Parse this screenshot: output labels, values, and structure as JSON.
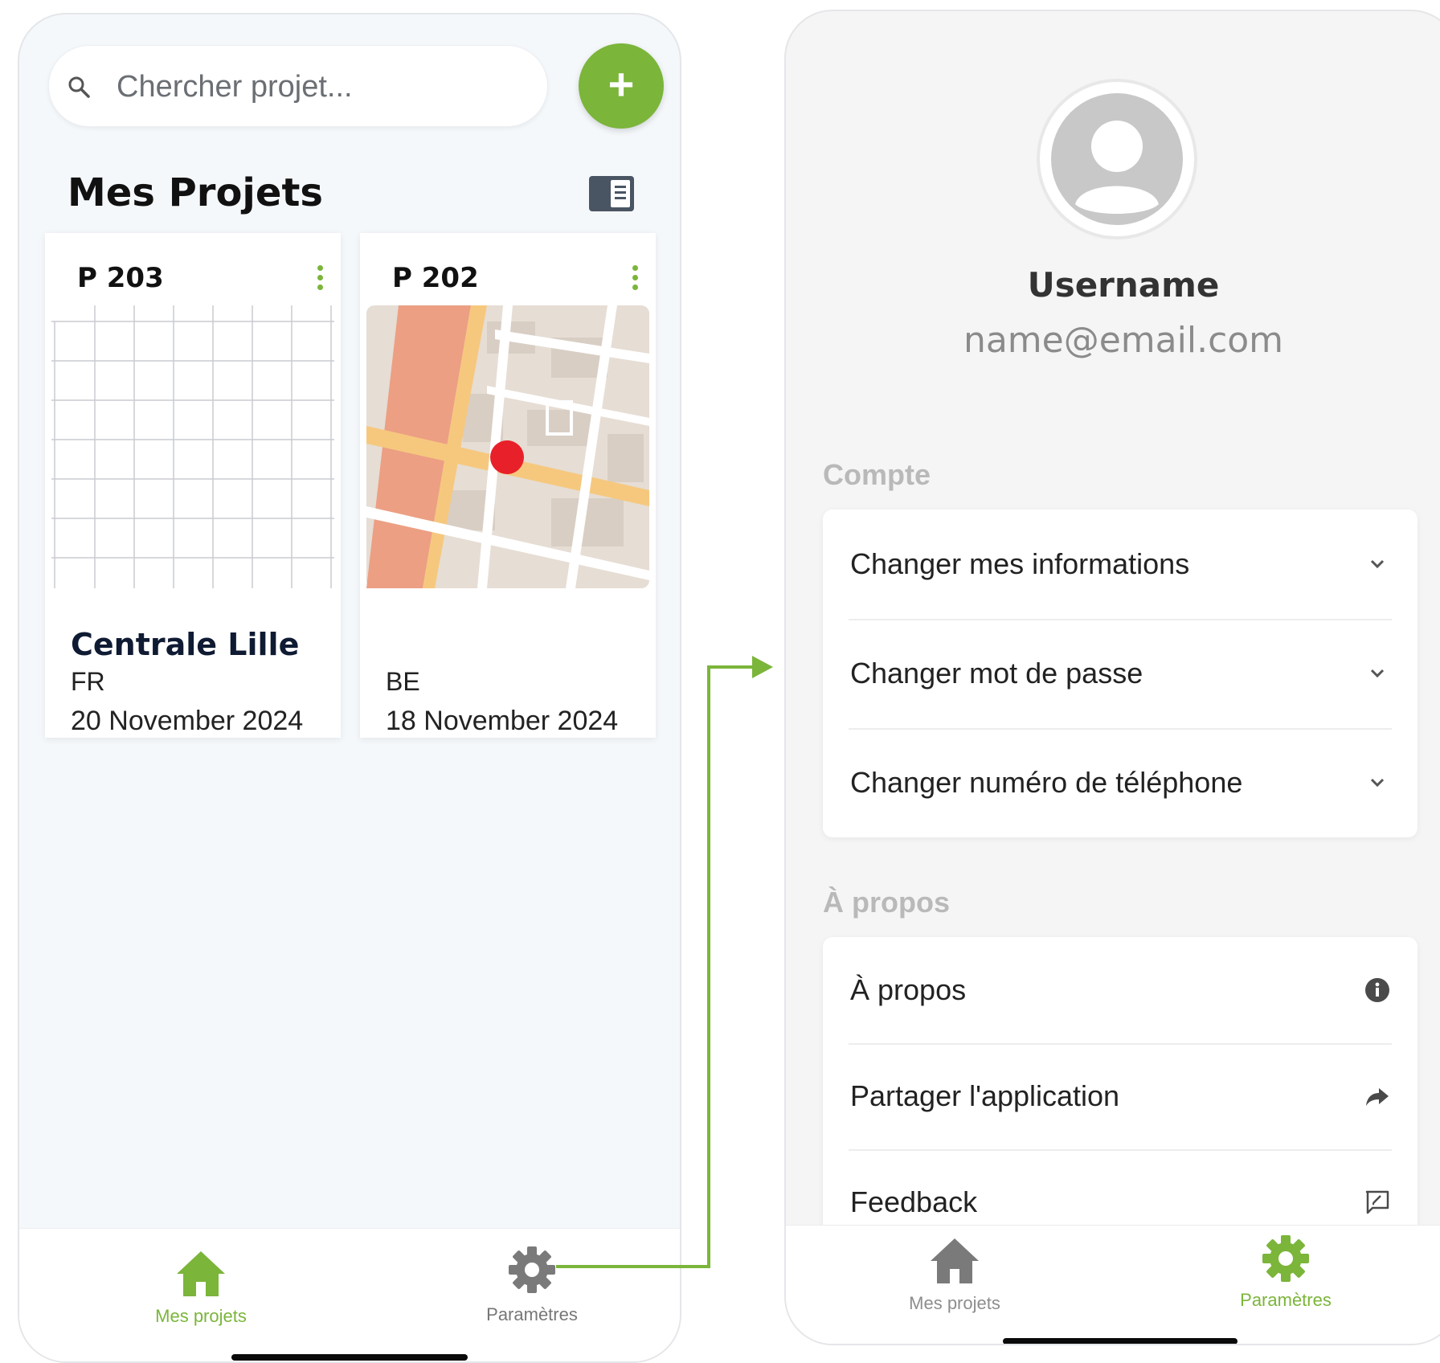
{
  "colors": {
    "accent": "#7bb53a",
    "marker": "#e8202a",
    "inactive": "#8d8d8d"
  },
  "projects_screen": {
    "search": {
      "placeholder": "Chercher projet..."
    },
    "add_button_label": "+",
    "title": "Mes Projets",
    "cards": [
      {
        "code": "P 203",
        "name": "Centrale Lille",
        "country": "FR",
        "date": "20 November 2024",
        "thumbnail": "empty-grid"
      },
      {
        "code": "P 202",
        "name": "",
        "country": "BE",
        "date": "18 November 2024",
        "thumbnail": "street-map"
      }
    ],
    "nav": {
      "home_label": "Mes projets",
      "settings_label": "Paramètres",
      "active": "home"
    }
  },
  "settings_screen": {
    "username": "Username",
    "email": "name@email.com",
    "account_section": {
      "title": "Compte",
      "items": [
        {
          "label": "Changer mes informations",
          "icon": "chevron-down-icon"
        },
        {
          "label": "Changer mot de passe",
          "icon": "chevron-down-icon"
        },
        {
          "label": "Changer numéro de téléphone",
          "icon": "chevron-down-icon"
        }
      ]
    },
    "about_section": {
      "title": "À propos",
      "items": [
        {
          "label": "À propos",
          "icon": "info-icon"
        },
        {
          "label": "Partager l'application",
          "icon": "share-icon"
        },
        {
          "label": "Feedback",
          "icon": "feedback-icon"
        }
      ]
    },
    "nav": {
      "home_label": "Mes projets",
      "settings_label": "Paramètres",
      "active": "settings"
    }
  }
}
